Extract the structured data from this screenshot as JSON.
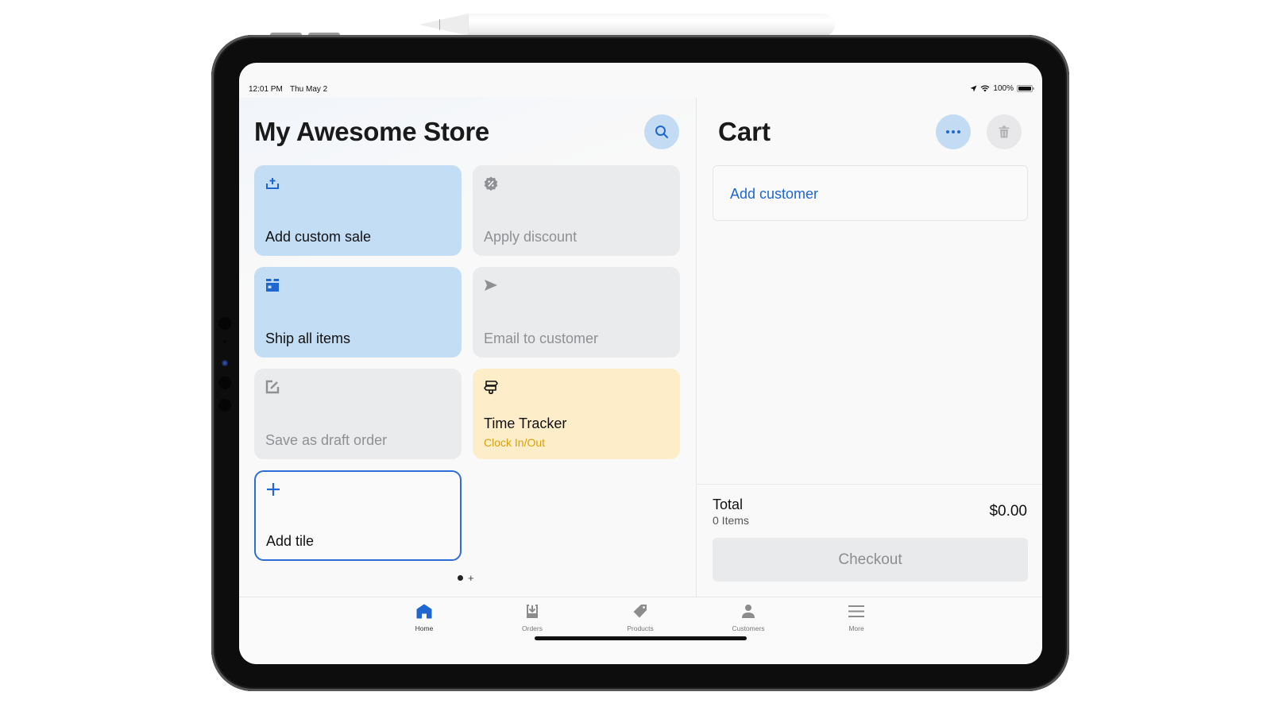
{
  "status_bar": {
    "time": "12:01 PM",
    "date": "Thu May 2",
    "battery": "100%",
    "battery_level": 1.0,
    "icons": [
      "location-arrow-icon",
      "wifi-icon",
      "battery-icon"
    ]
  },
  "store": {
    "title": "My Awesome Store",
    "search_icon": "search-icon"
  },
  "tiles": [
    {
      "label": "Add custom sale",
      "icon": "add-to-tray-icon",
      "style": "blue"
    },
    {
      "label": "Apply discount",
      "icon": "discount-badge-icon",
      "style": "gray"
    },
    {
      "label": "Ship all items",
      "icon": "shipping-box-icon",
      "style": "blue"
    },
    {
      "label": "Email to customer",
      "icon": "send-icon",
      "style": "gray"
    },
    {
      "label": "Save as draft order",
      "icon": "edit-note-icon",
      "style": "gray"
    },
    {
      "label": "Time Tracker",
      "sublabel": "Clock In/Out",
      "icon": "signpost-icon",
      "style": "yellow"
    },
    {
      "label": "Add tile",
      "icon": "plus-icon",
      "style": "outline"
    }
  ],
  "pager": {
    "current_page": 1,
    "pages": 1,
    "add_symbol": "+"
  },
  "cart": {
    "title": "Cart",
    "more_icon": "more-horizontal-icon",
    "trash_icon": "trash-icon",
    "add_customer_label": "Add customer",
    "total_label": "Total",
    "items_count": "0 Items",
    "total_amount": "$0.00",
    "checkout_label": "Checkout"
  },
  "tabbar": {
    "tabs": [
      {
        "label": "Home",
        "icon": "home-icon",
        "active": true
      },
      {
        "label": "Orders",
        "icon": "orders-inbox-icon",
        "active": false
      },
      {
        "label": "Products",
        "icon": "tag-icon",
        "active": false
      },
      {
        "label": "Customers",
        "icon": "person-icon",
        "active": false
      },
      {
        "label": "More",
        "icon": "menu-icon",
        "active": false
      }
    ]
  },
  "colors": {
    "accent": "#1f66d1",
    "tile_blue": "#c3ddf5",
    "tile_gray": "#eaebed",
    "tile_yellow": "#fdedc8",
    "tile_yellow_text": "#d9a109",
    "disabled_text": "#8f9094"
  }
}
